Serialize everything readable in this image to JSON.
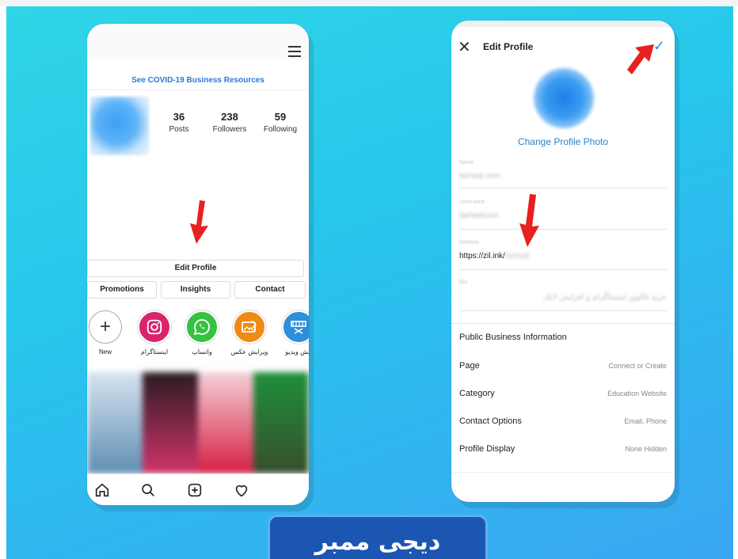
{
  "left_phone": {
    "covid_link": "See COVID-19 Business Resources",
    "stats": [
      {
        "num": "36",
        "label": "Posts"
      },
      {
        "num": "238",
        "label": "Followers"
      },
      {
        "num": "59",
        "label": "Following"
      }
    ],
    "edit_profile": "Edit Profile",
    "business_buttons": [
      "Promotions",
      "Insights",
      "Contact"
    ],
    "highlights": [
      {
        "label": "New",
        "icon": "plus-icon"
      },
      {
        "label": "اینستاگرام",
        "icon": "instagram-icon",
        "color": "#d8246a"
      },
      {
        "label": "واتساپ",
        "icon": "whatsapp-icon",
        "color": "#36c23f"
      },
      {
        "label": "ویرایش عکس",
        "icon": "photo-edit-icon",
        "color": "#f08a14"
      },
      {
        "label": "ایش ویدیو",
        "icon": "video-edit-icon",
        "color": "#2c8fd9"
      }
    ],
    "nav_icons": [
      "home-icon",
      "search-icon",
      "add-post-icon",
      "heart-icon"
    ]
  },
  "right_phone": {
    "title": "Edit Profile",
    "change_photo": "Change Profile Photo",
    "fields": {
      "name": {
        "label": "Name",
        "value": "farhadi.com"
      },
      "username": {
        "label": "Username",
        "value": "farhadicom"
      },
      "website": {
        "label": "Website",
        "value": "https://zil.ink/",
        "blurred_suffix": "farhadi"
      },
      "bio": {
        "label": "Bio",
        "value": "خرید فالوور اینستاگرام و افزایش لایک"
      }
    },
    "public_business_info": "Public Business Information",
    "rows": [
      {
        "label": "Page",
        "value": "Connect or Create"
      },
      {
        "label": "Category",
        "value": "Education Website"
      },
      {
        "label": "Contact Options",
        "value": "Email, Phone"
      },
      {
        "label": "Profile Display",
        "value": "None Hidden"
      }
    ]
  },
  "banner": {
    "text": "دیجی ممبر"
  },
  "colors": {
    "accent": "#2a8ee6",
    "arrow": "#e8201f",
    "banner": "#1c56b3"
  }
}
